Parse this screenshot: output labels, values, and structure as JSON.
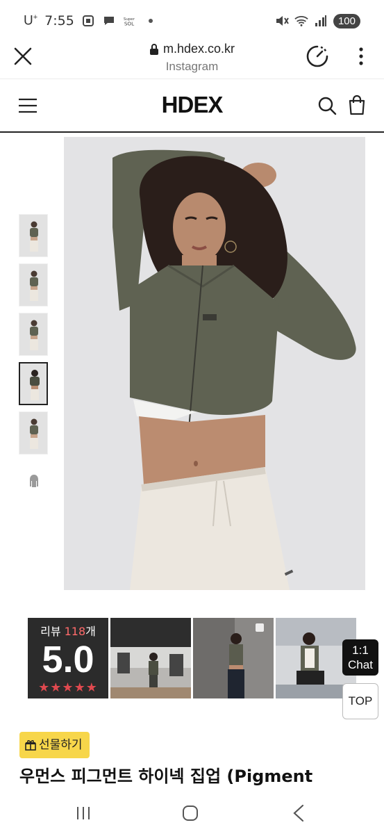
{
  "status_bar": {
    "carrier": "U",
    "carrier_sup": "+",
    "time": "7:55",
    "battery": "100"
  },
  "browser": {
    "url": "m.hdex.co.kr",
    "subtitle": "Instagram"
  },
  "site": {
    "logo": "HDEX"
  },
  "gallery": {
    "thumbnail_count": 6,
    "active_index": 3
  },
  "reviews": {
    "label": "리뷰 ",
    "count": "118",
    "suffix": "개",
    "score": "5.0",
    "stars": "★★★★★"
  },
  "floating": {
    "chat_line1": "1:1",
    "chat_line2": "Chat",
    "top": "TOP"
  },
  "product": {
    "gift_label": "선물하기",
    "title": "우먼스 피그먼트 하이넥 집업 (Pigment"
  },
  "colors": {
    "gift_badge": "#f7d64a",
    "review_card": "#2b2b2b",
    "review_count": "#ff6b6b",
    "stars": "#e0494f",
    "jacket": "#5f6252"
  }
}
